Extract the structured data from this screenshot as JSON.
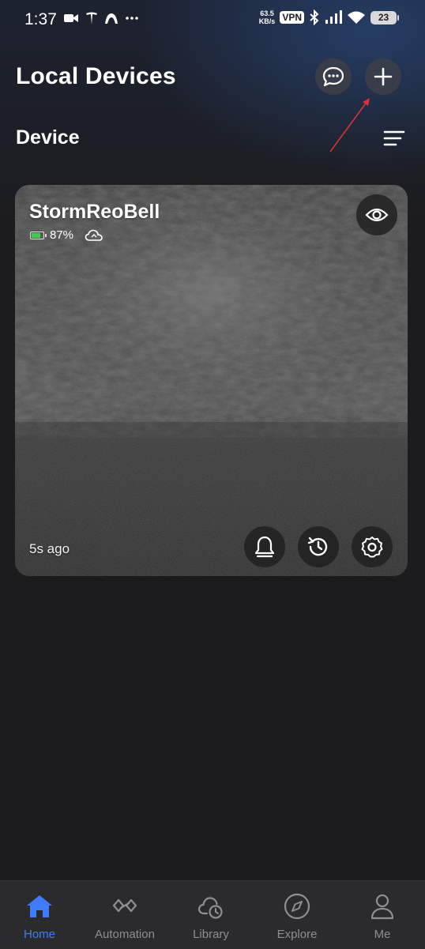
{
  "status_bar": {
    "time": "1:37",
    "speed_value": "63.5",
    "speed_unit": "KB/s",
    "vpn_label": "VPN",
    "battery_level": "23"
  },
  "header": {
    "title": "Local Devices",
    "section_title": "Device"
  },
  "device": {
    "name": "StormReoBell",
    "battery_percent": "87%",
    "last_seen": "5s ago"
  },
  "bottom_nav": {
    "items": [
      {
        "label": "Home",
        "icon": "home-icon",
        "active": true
      },
      {
        "label": "Automation",
        "icon": "automation-icon",
        "active": false
      },
      {
        "label": "Library",
        "icon": "cloud-clock-icon",
        "active": false
      },
      {
        "label": "Explore",
        "icon": "compass-icon",
        "active": false
      },
      {
        "label": "Me",
        "icon": "user-icon",
        "active": false
      }
    ]
  },
  "colors": {
    "accent": "#3f7bff",
    "background": "#1c1c1e",
    "nav_background": "#2b2b2d",
    "inactive": "#8e8e93",
    "battery_green": "#3ccf4e",
    "annotation_arrow": "#e0303a"
  }
}
